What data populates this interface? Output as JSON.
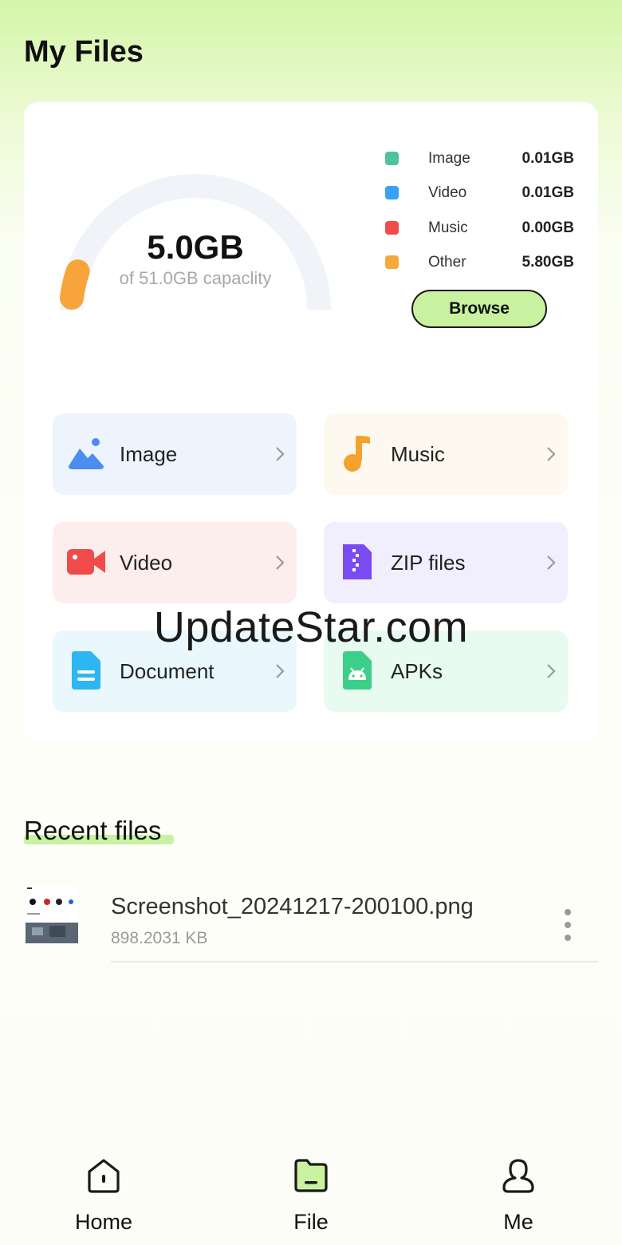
{
  "header": {
    "title": "My Files"
  },
  "storage": {
    "used": "5.0GB",
    "capacity": "of 51.0GB capaclity",
    "used_fraction": 0.1,
    "gauge_track_color": "#f0f4f8",
    "gauge_fill_color": "#f7a43a",
    "legend": [
      {
        "label": "Image",
        "value": "0.01GB",
        "color": "#4fc39a"
      },
      {
        "label": "Video",
        "value": "0.01GB",
        "color": "#3aa2f5"
      },
      {
        "label": "Music",
        "value": "0.00GB",
        "color": "#f24b4b"
      },
      {
        "label": "Other",
        "value": "5.80GB",
        "color": "#f7a83c"
      }
    ],
    "browse_label": "Browse"
  },
  "categories": [
    {
      "label": "Image",
      "icon": "image-icon",
      "bg": "#eef4fd",
      "icon_color": "#4c8df0"
    },
    {
      "label": "Music",
      "icon": "music-note-icon",
      "bg": "#fef9ee",
      "icon_color": "#f5a12e"
    },
    {
      "label": "Video",
      "icon": "video-camera-icon",
      "bg": "#fdeeee",
      "icon_color": "#f04b4b"
    },
    {
      "label": "ZIP files",
      "icon": "zip-file-icon",
      "bg": "#f1eefd",
      "icon_color": "#7a4af2"
    },
    {
      "label": "Document",
      "icon": "document-icon",
      "bg": "#eaf8fd",
      "icon_color": "#2db6f2"
    },
    {
      "label": "APKs",
      "icon": "android-icon",
      "bg": "#e8fbf0",
      "icon_color": "#3ccf8a"
    }
  ],
  "watermark": "UpdateStar.com",
  "recent": {
    "title": "Recent files",
    "files": [
      {
        "name": "Screenshot_20241217-200100.png",
        "size": "898.2031 KB",
        "icon": "image-thumbnail"
      }
    ]
  },
  "nav": {
    "items": [
      {
        "label": "Home",
        "icon": "home-icon",
        "active": false
      },
      {
        "label": "File",
        "icon": "folder-icon",
        "active": true
      },
      {
        "label": "Me",
        "icon": "person-icon",
        "active": false
      }
    ],
    "active_color": "#c8f2a0"
  }
}
